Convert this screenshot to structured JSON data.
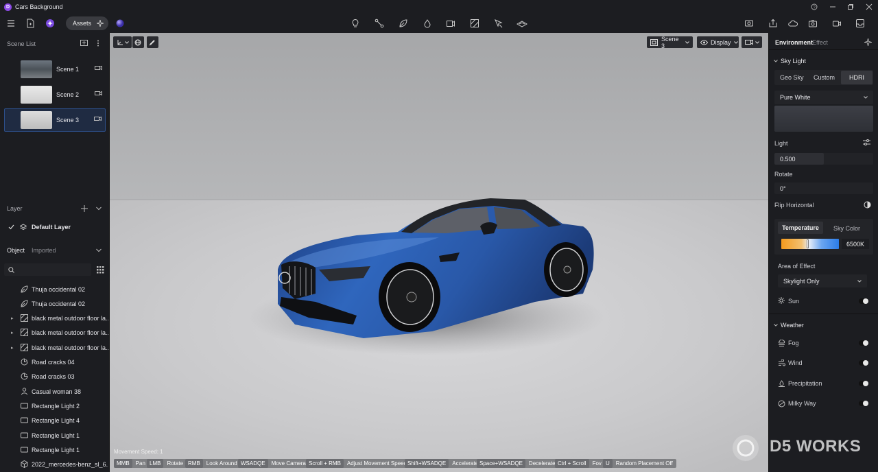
{
  "app": {
    "title": "Cars Background"
  },
  "toolbar": {
    "assets_label": "Assets"
  },
  "left": {
    "scene_list_title": "Scene List",
    "scenes": [
      {
        "label": "Scene 1"
      },
      {
        "label": "Scene 2"
      },
      {
        "label": "Scene 3"
      }
    ],
    "layer_title": "Layer",
    "default_layer": "Default Layer",
    "object_tab": "Object",
    "imported_tab": "Imported",
    "search_placeholder": "",
    "objects": [
      {
        "label": "Thuja occidental 02",
        "icon": "plant-icon"
      },
      {
        "label": "Thuja occidental 02",
        "icon": "plant-icon"
      },
      {
        "label": "black metal outdoor floor la...",
        "icon": "model-icon"
      },
      {
        "label": "black metal outdoor floor la...",
        "icon": "model-icon"
      },
      {
        "label": "black metal outdoor floor la...",
        "icon": "model-icon"
      },
      {
        "label": "Road cracks 04",
        "icon": "decal-icon"
      },
      {
        "label": "Road cracks 03",
        "icon": "decal-icon"
      },
      {
        "label": "Casual woman 38",
        "icon": "person-icon"
      },
      {
        "label": "Rectangle Light 2",
        "icon": "rect-light-icon"
      },
      {
        "label": "Rectangle Light 4",
        "icon": "rect-light-icon"
      },
      {
        "label": "Rectangle Light 1",
        "icon": "rect-light-icon"
      },
      {
        "label": "Rectangle Light 1",
        "icon": "rect-light-icon"
      },
      {
        "label": "2022_mercedes-benz_sl_6...",
        "icon": "cube-icon"
      }
    ]
  },
  "viewport": {
    "scene_select": "Scene 3",
    "display_label": "Display",
    "movement_speed": "Movement Speed: 1",
    "watermark": "D5 WORKS",
    "hints": [
      {
        "key": "MMB",
        "action": "Pan"
      },
      {
        "key": "LMB",
        "action": "Rotate"
      },
      {
        "key": "RMB",
        "action": "Look Around"
      },
      {
        "key": "WSADQE",
        "action": "Move Camera"
      },
      {
        "key": "Scroll + RMB",
        "action": "Adjust Movement Speed"
      },
      {
        "key": "Shift+WSADQE",
        "action": "Accelerate"
      },
      {
        "key": "Space+WSADQE",
        "action": "Decelerate"
      },
      {
        "key": "Ctrl + Scroll",
        "action": "Fov"
      },
      {
        "key": "U",
        "action": "Random Placement Off"
      }
    ]
  },
  "right": {
    "tab_environment": "Environment",
    "tab_effect": "Effect",
    "sky_light_title": "Sky Light",
    "sky_tabs": [
      "Geo Sky",
      "Custom",
      "HDRI"
    ],
    "hdri_select": "Pure White",
    "light_label": "Light",
    "light_value": "0.500",
    "rotate_label": "Rotate",
    "rotate_value": "0°",
    "flip_label": "Flip Horizontal",
    "temp_tab": "Temperature",
    "skycolor_tab": "Sky Color",
    "temp_value": "6500K",
    "area_label": "Area of Effect",
    "area_select": "Skylight Only",
    "sun_label": "Sun",
    "weather_title": "Weather",
    "weather_items": [
      {
        "label": "Fog",
        "icon": "fog-icon"
      },
      {
        "label": "Wind",
        "icon": "wind-icon"
      },
      {
        "label": "Precipitation",
        "icon": "precipitation-icon"
      },
      {
        "label": "Milky Way",
        "icon": "milky-way-icon"
      }
    ]
  }
}
